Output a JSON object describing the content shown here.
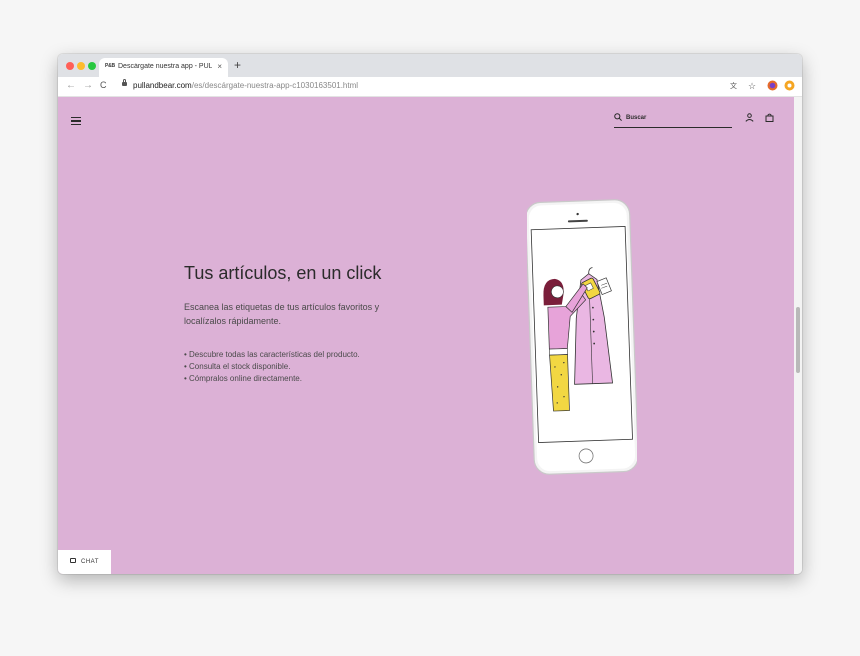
{
  "browser": {
    "tab": {
      "favicon_text": "P&B",
      "title": "Descárgate nuestra app - PULL",
      "close": "×"
    },
    "new_tab": "+",
    "nav": {
      "back": "←",
      "forward": "→",
      "reload": "C"
    },
    "url": {
      "domain": "pullandbear.com",
      "path": "/es/descárgate-nuestra-app-c1030163501.html"
    },
    "traffic_lights": [
      "#ff5f57",
      "#febc2e",
      "#28c840"
    ],
    "extensions": [
      "translate-icon",
      "star-icon",
      "firefox-icon",
      "extension-icon"
    ]
  },
  "header": {
    "menu_icon": "hamburger-icon",
    "search": {
      "placeholder": "Buscar",
      "icon": "search-icon"
    },
    "account_icon": "user-icon",
    "bag_icon": "shopping-bag-icon"
  },
  "hero": {
    "heading": "Tus artículos, en un click",
    "description": "Escanea las etiquetas de tus artículos favoritos y localízalos rápidamente.",
    "features": [
      "Descubre todas las características del producto.",
      "Consulta el stock disponible.",
      "Cómpralos online directamente."
    ],
    "illustration": "phone-scanning-illustration"
  },
  "chat": {
    "label": "CHAT",
    "icon": "chat-icon"
  },
  "colors": {
    "page_background": "#dcb1d6",
    "text": "#2b2b2b",
    "garment_pink": "#e9a9dc",
    "pants_yellow": "#f2d742"
  }
}
